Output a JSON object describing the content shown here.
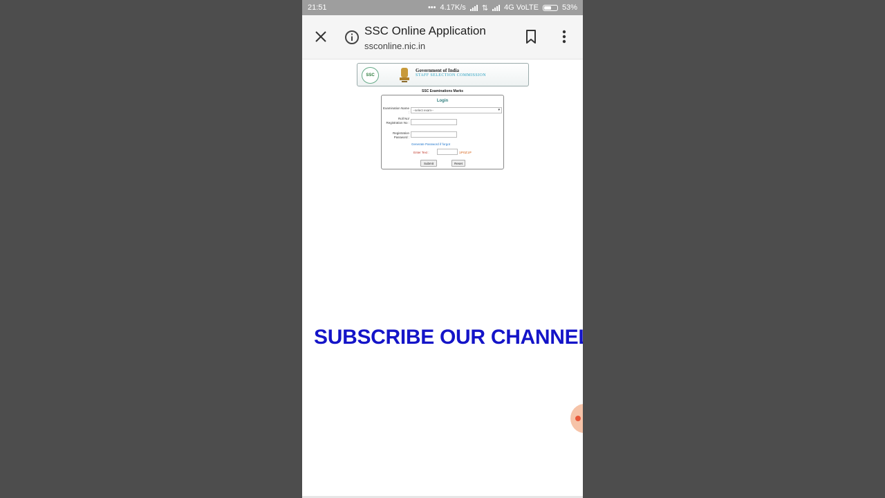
{
  "status_bar": {
    "time": "21:51",
    "speed": "4.17K/s",
    "network": "4G VoLTE",
    "battery_percent": "53%",
    "battery_level": 0.53
  },
  "browser": {
    "page_title": "SSC Online Application",
    "url": "ssconline.nic.in",
    "icons": [
      "close-icon",
      "info-icon",
      "bookmark-icon",
      "more-vert-icon"
    ]
  },
  "banner": {
    "logo_text": "SSC",
    "gov_text": "Government of India",
    "commission_text": "STAFF SELECTION COMMISSION"
  },
  "page": {
    "heading": "SSC Examinations Marks"
  },
  "login": {
    "title": "Login",
    "exam_label": "Examination Name :",
    "exam_select_value": "--select exam--",
    "roll_label": "Roll No/ Registration No :",
    "roll_value": "",
    "password_label": "Registration Password :",
    "password_value": "",
    "generate_link": "Generate Password if forgot",
    "enter_text_label": "Enter Text :",
    "enter_text_value": "",
    "captcha": "1P0Z1P",
    "submit_label": "Submit",
    "reset_label": "Reset"
  },
  "overlay": {
    "subscribe_text": "SUBSCRIBE OUR CHANNEL"
  },
  "colors": {
    "subscribe": "#1414c8",
    "status_bar": "#9e9e9e",
    "captcha": "#d35400",
    "link": "#2277cc"
  }
}
